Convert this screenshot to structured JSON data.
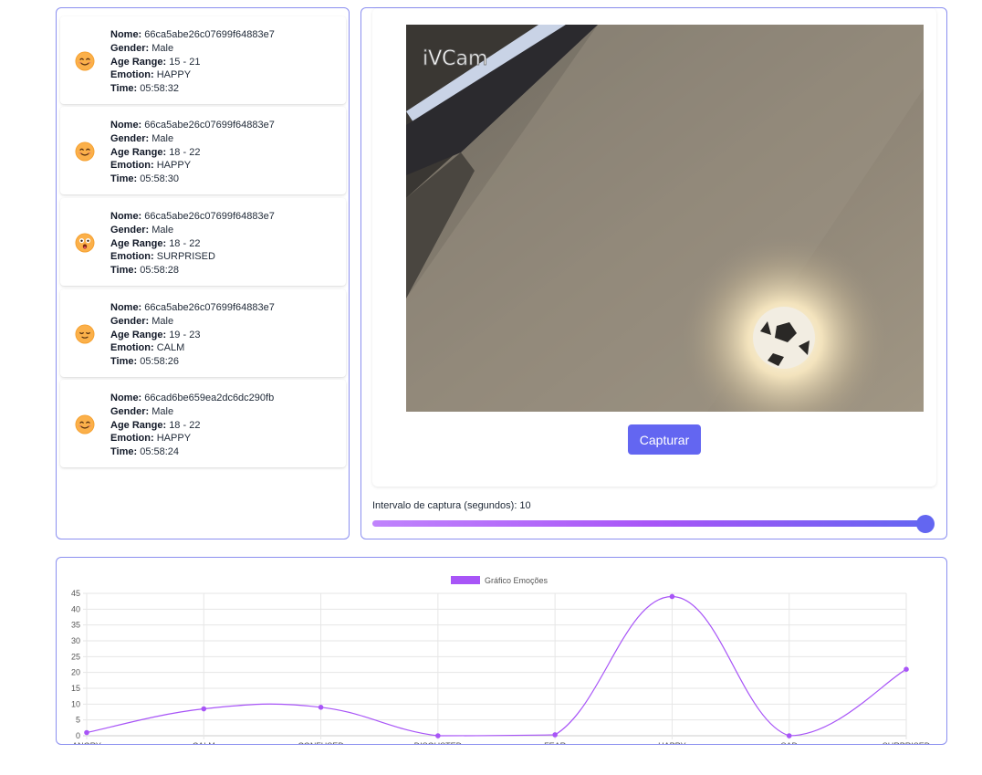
{
  "detections": [
    {
      "nome": "66ca5abe26c07699f64883e7",
      "gender": "Male",
      "age_range": "15 - 21",
      "emotion": "HAPPY",
      "time": "05:58:32",
      "emoji": "smiling-face-icon"
    },
    {
      "nome": "66ca5abe26c07699f64883e7",
      "gender": "Male",
      "age_range": "18 - 22",
      "emotion": "HAPPY",
      "time": "05:58:30",
      "emoji": "smiling-face-icon"
    },
    {
      "nome": "66ca5abe26c07699f64883e7",
      "gender": "Male",
      "age_range": "18 - 22",
      "emotion": "SURPRISED",
      "time": "05:58:28",
      "emoji": "surprised-face-icon"
    },
    {
      "nome": "66ca5abe26c07699f64883e7",
      "gender": "Male",
      "age_range": "19 - 23",
      "emotion": "CALM",
      "time": "05:58:26",
      "emoji": "relieved-face-icon"
    },
    {
      "nome": "66cad6be659ea2dc6dc290fb",
      "gender": "Male",
      "age_range": "18 - 22",
      "emotion": "HAPPY",
      "time": "05:58:24",
      "emoji": "smiling-face-icon"
    }
  ],
  "labels": {
    "nome": "Nome:",
    "gender": "Gender:",
    "age_range": "Age Range:",
    "emotion": "Emotion:",
    "time": "Time:"
  },
  "camera": {
    "watermark": "iVCam",
    "capture_button": "Capturar",
    "interval_label": "Intervalo de captura (segundos): 10",
    "interval_value": 10,
    "interval_fraction": 1.0
  },
  "colors": {
    "accent": "#6366f1",
    "series": "#a855f7",
    "panel_border": "#8b8ff0"
  },
  "chart_data": {
    "type": "line",
    "categories": [
      "ANGRY",
      "CALM",
      "CONFUSED",
      "DISGUSTED",
      "FEAR",
      "HAPPY",
      "SAD",
      "SURPRISED"
    ],
    "series": [
      {
        "name": "Gráfico Emoções",
        "values": [
          1,
          8.5,
          9,
          0,
          0.3,
          44,
          0,
          21
        ],
        "color": "#a855f7"
      }
    ],
    "ylim": [
      0,
      45
    ],
    "yticks": [
      0,
      5,
      10,
      15,
      20,
      25,
      30,
      35,
      40,
      45
    ],
    "grid": true,
    "legend": "top-center",
    "title": "",
    "xlabel": "",
    "ylabel": ""
  }
}
